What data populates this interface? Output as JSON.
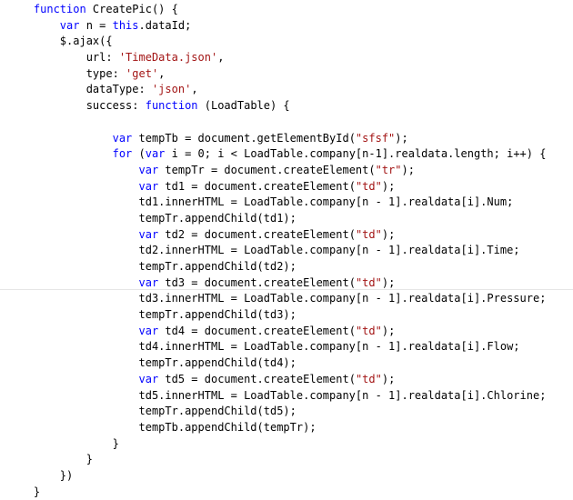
{
  "colors": {
    "keyword": "#0000ff",
    "string": "#a31515",
    "text": "#000000",
    "background": "#ffffff"
  },
  "code": {
    "lines": [
      [
        {
          "t": "    "
        },
        {
          "t": "function",
          "k": "keyword"
        },
        {
          "t": " CreatePic() {"
        }
      ],
      [
        {
          "t": "        "
        },
        {
          "t": "var",
          "k": "keyword"
        },
        {
          "t": " n = "
        },
        {
          "t": "this",
          "k": "keyword"
        },
        {
          "t": ".dataId;"
        }
      ],
      [
        {
          "t": "        $.ajax({"
        }
      ],
      [
        {
          "t": "            url: "
        },
        {
          "t": "'TimeData.json'",
          "k": "string"
        },
        {
          "t": ","
        }
      ],
      [
        {
          "t": "            type: "
        },
        {
          "t": "'get'",
          "k": "string"
        },
        {
          "t": ","
        }
      ],
      [
        {
          "t": "            dataType: "
        },
        {
          "t": "'json'",
          "k": "string"
        },
        {
          "t": ","
        }
      ],
      [
        {
          "t": "            success: "
        },
        {
          "t": "function",
          "k": "keyword"
        },
        {
          "t": " (LoadTable) {"
        }
      ],
      [
        {
          "t": ""
        }
      ],
      [
        {
          "t": "                "
        },
        {
          "t": "var",
          "k": "keyword"
        },
        {
          "t": " tempTb = document.getElementById("
        },
        {
          "t": "\"sfsf\"",
          "k": "string"
        },
        {
          "t": ");"
        }
      ],
      [
        {
          "t": "                "
        },
        {
          "t": "for",
          "k": "keyword"
        },
        {
          "t": " ("
        },
        {
          "t": "var",
          "k": "keyword"
        },
        {
          "t": " i = 0; i < LoadTable.company[n-1].realdata.length; i++) {"
        }
      ],
      [
        {
          "t": "                    "
        },
        {
          "t": "var",
          "k": "keyword"
        },
        {
          "t": " tempTr = document.createElement("
        },
        {
          "t": "\"tr\"",
          "k": "string"
        },
        {
          "t": ");"
        }
      ],
      [
        {
          "t": "                    "
        },
        {
          "t": "var",
          "k": "keyword"
        },
        {
          "t": " td1 = document.createElement("
        },
        {
          "t": "\"td\"",
          "k": "string"
        },
        {
          "t": ");"
        }
      ],
      [
        {
          "t": "                    td1.innerHTML = LoadTable.company[n - 1].realdata[i].Num;"
        }
      ],
      [
        {
          "t": "                    tempTr.appendChild(td1);"
        }
      ],
      [
        {
          "t": "                    "
        },
        {
          "t": "var",
          "k": "keyword"
        },
        {
          "t": " td2 = document.createElement("
        },
        {
          "t": "\"td\"",
          "k": "string"
        },
        {
          "t": ");"
        }
      ],
      [
        {
          "t": "                    td2.innerHTML = LoadTable.company[n - 1].realdata[i].Time;"
        }
      ],
      [
        {
          "t": "                    tempTr.appendChild(td2);"
        }
      ],
      [
        {
          "t": "                    "
        },
        {
          "t": "var",
          "k": "keyword"
        },
        {
          "t": " td3 = document.createElement("
        },
        {
          "t": "\"td\"",
          "k": "string"
        },
        {
          "t": ");"
        }
      ],
      [
        {
          "t": "                    td3.innerHTML = LoadTable.company[n - 1].realdata[i].Pressure;"
        }
      ],
      [
        {
          "t": "                    tempTr.appendChild(td3);"
        }
      ],
      [
        {
          "t": "                    "
        },
        {
          "t": "var",
          "k": "keyword"
        },
        {
          "t": " td4 = document.createElement("
        },
        {
          "t": "\"td\"",
          "k": "string"
        },
        {
          "t": ");"
        }
      ],
      [
        {
          "t": "                    td4.innerHTML = LoadTable.company[n - 1].realdata[i].Flow;"
        }
      ],
      [
        {
          "t": "                    tempTr.appendChild(td4);"
        }
      ],
      [
        {
          "t": "                    "
        },
        {
          "t": "var",
          "k": "keyword"
        },
        {
          "t": " td5 = document.createElement("
        },
        {
          "t": "\"td\"",
          "k": "string"
        },
        {
          "t": ");"
        }
      ],
      [
        {
          "t": "                    td5.innerHTML = LoadTable.company[n - 1].realdata[i].Chlorine;"
        }
      ],
      [
        {
          "t": "                    tempTr.appendChild(td5);"
        }
      ],
      [
        {
          "t": "                    tempTb.appendChild(tempTr);"
        }
      ],
      [
        {
          "t": "                }"
        }
      ],
      [
        {
          "t": "            }"
        }
      ],
      [
        {
          "t": "        })"
        }
      ],
      [
        {
          "t": "    }"
        }
      ]
    ]
  }
}
